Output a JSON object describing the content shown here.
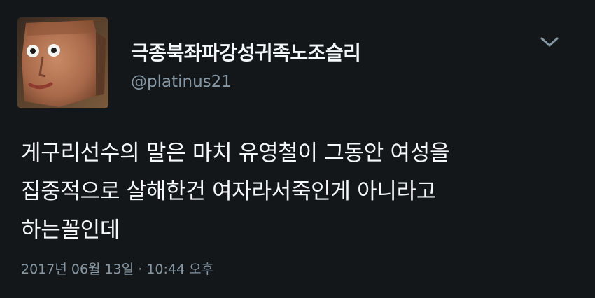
{
  "user": {
    "display_name": "극종북좌파강성귀족노조슬리",
    "handle": "@platinus21"
  },
  "tweet": {
    "text": "게구리선수의 말은 마치 유영철이 그동안 여성을\n집중적으로 살해한건 여자라서죽인게 아니라고\n하는꼴인데",
    "timestamp": "2017년 06월 13일 · 10:44 오후"
  },
  "icons": {
    "menu": "chevron-down-icon",
    "avatar": "avatar-image"
  },
  "colors": {
    "background": "#14171a",
    "primary_text": "#f5f8fa",
    "secondary_text": "#8899a6"
  }
}
